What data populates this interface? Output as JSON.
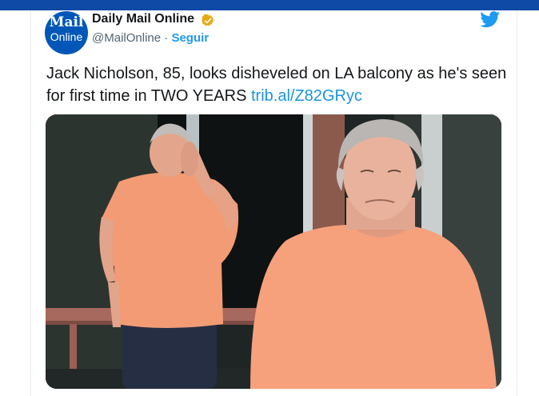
{
  "colors": {
    "accent": "#1d9bf0",
    "link": "#1b95e0",
    "top_bar": "#0f4aa6",
    "shirt": "#f4a07a"
  },
  "account": {
    "avatar_line1": "Mail",
    "avatar_line2": "Online",
    "name": "Daily Mail Online",
    "verified_icon": "verified-badge-icon",
    "handle": "@MailOnline",
    "separator": "·",
    "follow_label": "Seguir"
  },
  "platform_icon": "twitter-bird-icon",
  "tweet": {
    "text": "Jack Nicholson, 85, looks disheveled on LA balcony as he's seen for first time in TWO YEARS ",
    "link": "trib.al/Z82GRyc"
  }
}
